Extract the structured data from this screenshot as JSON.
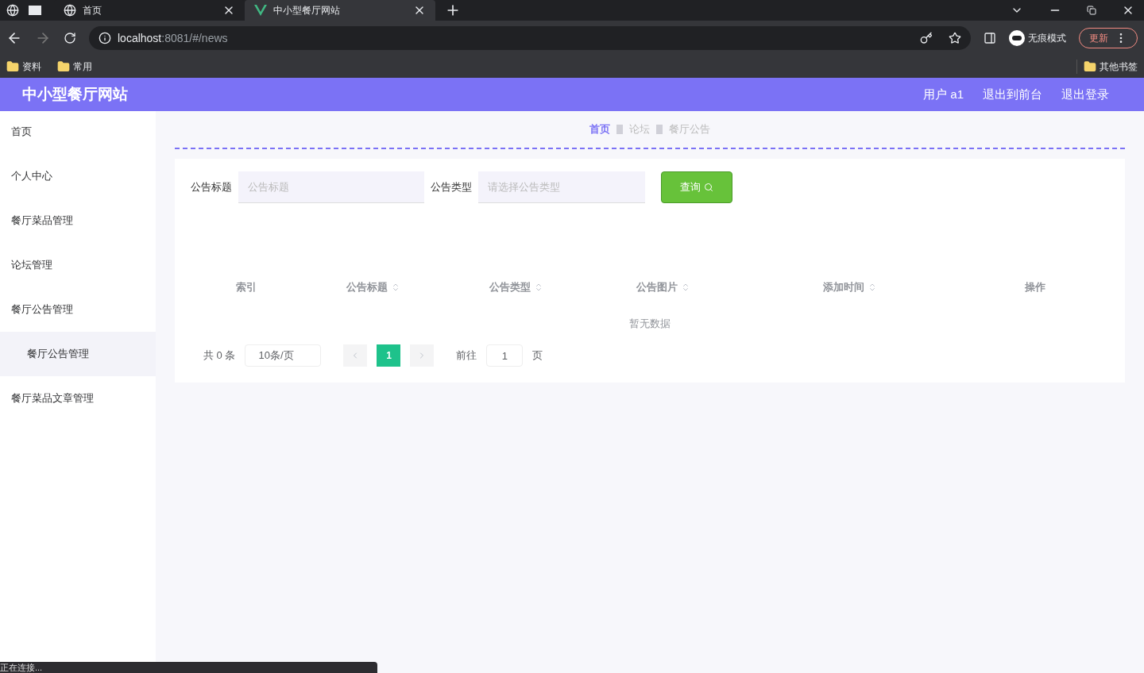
{
  "browser": {
    "tabs": [
      {
        "title": "首页",
        "selected": false
      },
      {
        "title": "中小型餐厅网站",
        "selected": true
      }
    ],
    "address": {
      "host": "localhost",
      "path": ":8081/#/news"
    },
    "profile": "无痕模式",
    "update_button": "更新",
    "bookmarks": [
      "资料",
      "常用"
    ],
    "other_bookmarks": "其他书签"
  },
  "header": {
    "title": "中小型餐厅网站",
    "links": [
      "用户 a1",
      "退出到前台",
      "退出登录"
    ]
  },
  "sidebar": {
    "items": [
      {
        "label": "首页",
        "selected": false
      },
      {
        "label": "个人中心",
        "selected": false
      },
      {
        "label": "餐厅菜品管理",
        "selected": false
      },
      {
        "label": "论坛管理",
        "selected": false
      },
      {
        "label": "餐厅公告管理",
        "selected": false,
        "children": [
          {
            "label": "餐厅公告管理",
            "selected": true
          }
        ]
      },
      {
        "label": "餐厅菜品文章管理",
        "selected": false
      }
    ]
  },
  "breadcrumb": [
    "首页",
    "论坛",
    "餐厅公告"
  ],
  "search": {
    "fields": [
      {
        "label": "公告标题",
        "placeholder": "公告标题",
        "kind": "input"
      },
      {
        "label": "公告类型",
        "placeholder": "请选择公告类型",
        "kind": "select"
      }
    ],
    "button": "查询"
  },
  "table": {
    "columns": [
      {
        "label": "索引",
        "sortable": false
      },
      {
        "label": "公告标题",
        "sortable": true
      },
      {
        "label": "公告类型",
        "sortable": true
      },
      {
        "label": "公告图片",
        "sortable": true
      },
      {
        "label": "添加时间",
        "sortable": true
      },
      {
        "label": "操作",
        "sortable": false
      }
    ],
    "empty_text": "暂无数据"
  },
  "pagination": {
    "total": "共 0 条",
    "page_size": "10条/页",
    "pages": [
      {
        "label": "1",
        "selected": true
      }
    ],
    "goto_label": "前往",
    "goto_value": "1",
    "goto_suffix": "页"
  },
  "status_bar": "正在连接..."
}
